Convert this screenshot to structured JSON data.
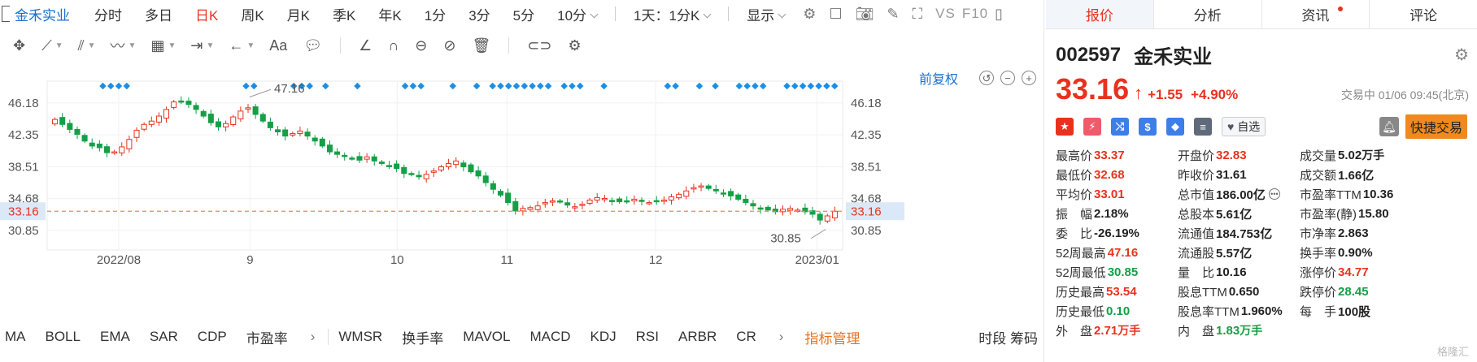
{
  "top_bar": {
    "stock_name": "金禾实业",
    "periods": [
      "分时",
      "多日",
      "日K",
      "周K",
      "月K",
      "季K",
      "年K",
      "1分",
      "3分",
      "5分",
      "10分"
    ],
    "active_period": "日K",
    "interval_select": "1天：1分K",
    "display_label": "显示",
    "vs_label": "VS",
    "f10_label": "F10"
  },
  "chart": {
    "adjust_label": "前复权",
    "y_ticks": [
      "46.18",
      "42.35",
      "38.51",
      "34.68",
      "30.85"
    ],
    "current_price_label": "33.16",
    "high_label": "47.16",
    "low_label": "30.85",
    "x_labels": [
      "2022/08",
      "9",
      "10",
      "11",
      "12",
      "2023/01"
    ],
    "colors": {
      "up": "#e8321e",
      "down": "#13a046",
      "marker": "#1a8fe8",
      "price_line": "#f08a4b"
    }
  },
  "chart_data": {
    "type": "candlestick",
    "y_ticks": [
      46.18,
      42.35,
      38.51,
      34.68,
      30.85
    ],
    "current_price": 33.16,
    "period_high": 47.16,
    "period_low": 30.85,
    "x_tick_labels": [
      "2022/08",
      "9",
      "10",
      "11",
      "12",
      "2023/01"
    ],
    "close_trend": [
      44.2,
      43.6,
      43.0,
      42.4,
      41.6,
      41.0,
      40.8,
      40.2,
      40.3,
      40.9,
      41.8,
      42.9,
      43.6,
      44.0,
      44.6,
      45.4,
      46.3,
      46.4,
      46.0,
      45.4,
      44.6,
      43.8,
      43.3,
      43.7,
      44.5,
      45.2,
      45.6,
      44.8,
      44.0,
      43.2,
      42.7,
      42.2,
      42.5,
      42.8,
      42.2,
      41.6,
      41.0,
      40.3,
      40.0,
      39.8,
      39.5,
      39.3,
      39.7,
      39.2,
      38.9,
      38.6,
      38.3,
      37.7,
      37.6,
      37.3,
      37.6,
      38.0,
      38.5,
      38.9,
      39.2,
      38.5,
      37.9,
      37.4,
      36.6,
      35.8,
      35.1,
      34.2,
      33.2,
      33.5,
      33.6,
      33.8,
      34.2,
      34.4,
      34.3,
      33.9,
      33.7,
      34.0,
      34.5,
      34.8,
      34.7,
      34.4,
      34.3,
      34.4,
      34.6,
      34.4,
      34.2,
      34.3,
      34.5,
      34.9,
      35.2,
      35.6,
      36.0,
      36.2,
      35.9,
      35.6,
      35.3,
      35.0,
      34.6,
      34.2,
      33.8,
      33.4,
      33.3,
      33.1,
      33.4,
      33.5,
      33.3,
      33.1,
      32.8,
      32.1,
      32.6,
      33.16
    ],
    "marker_columns": [
      0.07,
      0.08,
      0.09,
      0.1,
      0.25,
      0.26,
      0.31,
      0.32,
      0.33,
      0.35,
      0.39,
      0.45,
      0.46,
      0.47,
      0.51,
      0.54,
      0.56,
      0.57,
      0.58,
      0.59,
      0.6,
      0.61,
      0.62,
      0.63,
      0.65,
      0.66,
      0.67,
      0.7,
      0.78,
      0.79,
      0.82,
      0.84,
      0.87,
      0.88,
      0.89,
      0.9,
      0.93,
      0.94,
      0.95,
      0.96,
      0.97,
      0.98,
      0.99
    ]
  },
  "indicators": {
    "items": [
      "MA",
      "BOLL",
      "EMA",
      "SAR",
      "CDP",
      "市盈率",
      "WMSR",
      "换手率",
      "MAVOL",
      "MACD",
      "KDJ",
      "RSI",
      "ARBR",
      "CR"
    ],
    "manage_label": "指标管理",
    "right_tabs": "时段  筹码"
  },
  "panel": {
    "tabs": [
      "报价",
      "分析",
      "资讯",
      "评论"
    ],
    "active_tab": "报价",
    "code": "002597",
    "name": "金禾实业",
    "price": "33.16",
    "change": "+1.55",
    "change_pct": "+4.90%",
    "status": "交易中 01/06 09:45(北京)",
    "watchlist_label": "自选",
    "quick_trade_label": "快捷交易",
    "rows": [
      [
        {
          "k": "最高价",
          "v": "33.37",
          "c": "red"
        },
        {
          "k": "开盘价",
          "v": "32.83",
          "c": "red"
        },
        {
          "k": "成交量",
          "v": "5.02",
          "u": "万手",
          "c": "dark"
        }
      ],
      [
        {
          "k": "最低价",
          "v": "32.68",
          "c": "red"
        },
        {
          "k": "昨收价",
          "v": "31.61",
          "c": "dark"
        },
        {
          "k": "成交额",
          "v": "1.66亿",
          "c": "dark"
        }
      ],
      [
        {
          "k": "平均价",
          "v": "33.01",
          "c": "red"
        },
        {
          "k": "总市值",
          "v": "186.00亿",
          "c": "dark"
        },
        {
          "k": "市盈率TTM",
          "v": "10.36",
          "c": "dark"
        }
      ],
      [
        {
          "k": "振　幅",
          "v": "2.18%",
          "c": "dark"
        },
        {
          "k": "总股本",
          "v": "5.61亿",
          "c": "dark"
        },
        {
          "k": "市盈率(静)",
          "v": "15.80",
          "c": "dark"
        }
      ],
      [
        {
          "k": "委　比",
          "v": "-26.19%",
          "c": "dark"
        },
        {
          "k": "流通值",
          "v": "184.753亿",
          "c": "dark"
        },
        {
          "k": "市净率",
          "v": "2.863",
          "c": "dark"
        }
      ],
      [
        {
          "k": "52周最高",
          "v": "47.16",
          "c": "red"
        },
        {
          "k": "流通股",
          "v": "5.57亿",
          "c": "dark"
        },
        {
          "k": "换手率",
          "v": "0.90%",
          "c": "dark"
        }
      ],
      [
        {
          "k": "52周最低",
          "v": "30.85",
          "c": "green"
        },
        {
          "k": "量　比",
          "v": "10.16",
          "c": "dark"
        },
        {
          "k": "涨停价",
          "v": "34.77",
          "c": "red"
        }
      ],
      [
        {
          "k": "历史最高",
          "v": "53.54",
          "c": "red"
        },
        {
          "k": "股息TTM",
          "v": "0.650",
          "c": "dark"
        },
        {
          "k": "跌停价",
          "v": "28.45",
          "c": "green"
        }
      ],
      [
        {
          "k": "历史最低",
          "v": "0.10",
          "c": "green"
        },
        {
          "k": "股息率TTM",
          "v": "1.960%",
          "c": "dark"
        },
        {
          "k": "每　手",
          "v": "100股",
          "c": "dark"
        }
      ],
      [
        {
          "k": "外　盘",
          "v": "2.71",
          "u": "万手",
          "c": "red"
        },
        {
          "k": "内　盘",
          "v": "1.83",
          "u": "万手",
          "c": "green"
        },
        {
          "k": "",
          "v": "",
          "c": "dark"
        }
      ]
    ],
    "watermark": "格隆汇"
  }
}
